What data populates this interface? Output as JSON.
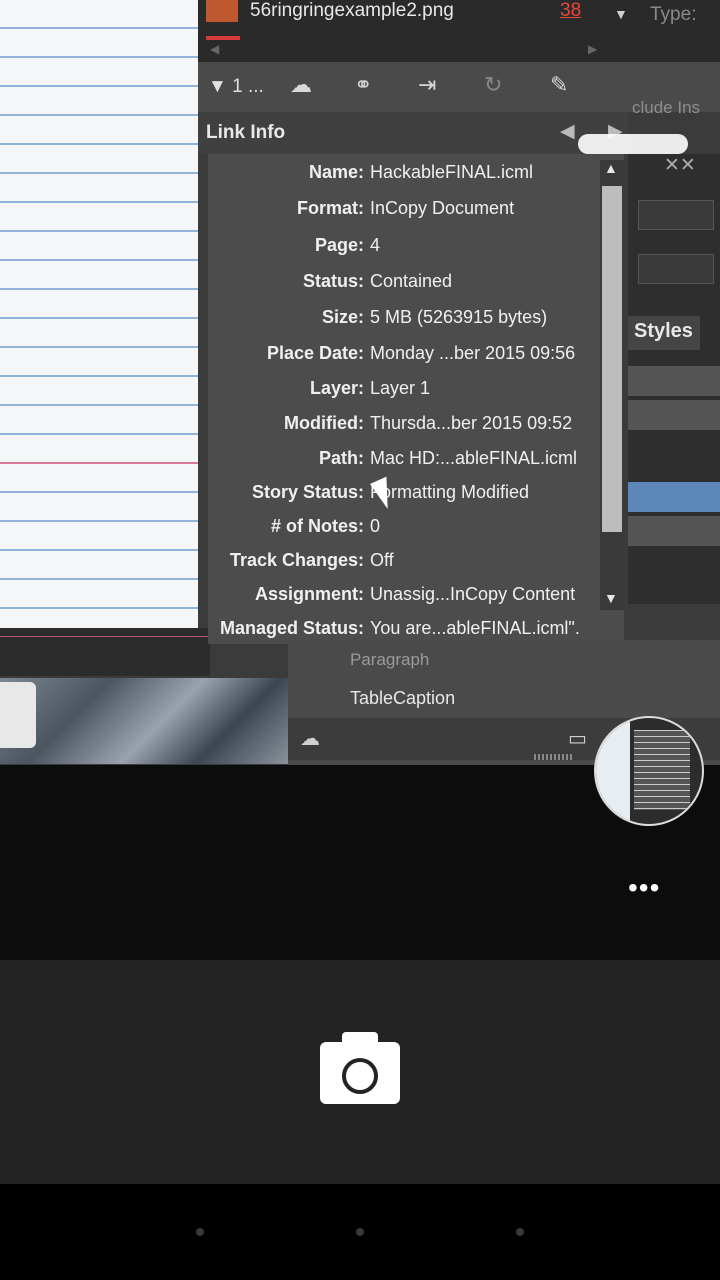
{
  "document": {
    "filename": "56ringringexample2.png",
    "page_number": "38",
    "type_label": "Type:",
    "include_label": "clude Ins"
  },
  "toolbar": {
    "collapse_label": "1 ...",
    "icons": [
      "cloud-link-icon",
      "chain-link-icon",
      "relink-icon",
      "update-icon",
      "edit-pencil-icon"
    ]
  },
  "link_info": {
    "title": "Link Info",
    "rows": [
      {
        "label": "Name:",
        "value": "HackableFINAL.icml"
      },
      {
        "label": "Format:",
        "value": "InCopy Document"
      },
      {
        "label": "Page:",
        "value": "4"
      },
      {
        "label": "Status:",
        "value": "Contained"
      },
      {
        "label": "Size:",
        "value": "5 MB (5263915 bytes)"
      },
      {
        "label": "Place Date:",
        "value": "Monday ...ber 2015 09:56"
      },
      {
        "label": "Layer:",
        "value": "Layer 1"
      },
      {
        "label": "Modified:",
        "value": "Thursda...ber 2015 09:52"
      },
      {
        "label": "Path:",
        "value": "Mac HD:...ableFINAL.icml"
      },
      {
        "label": "Story Status:",
        "value": "Formatting Modified"
      },
      {
        "label": "# of Notes:",
        "value": "0"
      },
      {
        "label": "Track Changes:",
        "value": "Off"
      },
      {
        "label": "Assignment:",
        "value": "Unassig...InCopy Content"
      },
      {
        "label": "Managed Status:",
        "value": "You are...ableFINAL.icml\"."
      }
    ]
  },
  "styles_panel": {
    "tab_label": "Styles",
    "items": [
      "Paragraph",
      "TableCaption"
    ]
  },
  "camera": {
    "more_label": "•••"
  }
}
